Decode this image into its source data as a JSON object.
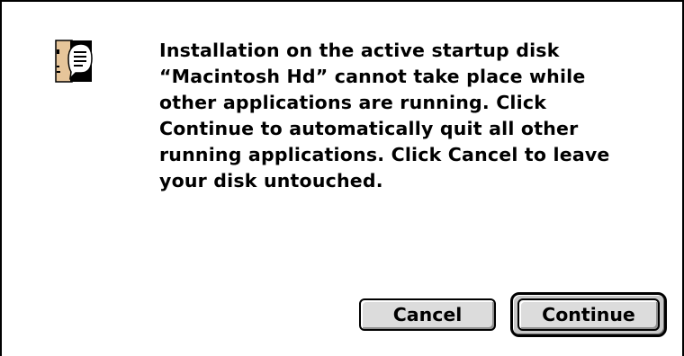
{
  "dialog": {
    "message": "Installation on the active startup disk\n“Macintosh Hd” cannot take place while\nother applications are running.  Click\nContinue to automatically quit all other\nrunning applications.  Click Cancel to leave\nyour disk untouched.",
    "icon": "note-alert-icon"
  },
  "buttons": {
    "cancel_label": "Cancel",
    "continue_label": "Continue"
  },
  "colors": {
    "button_face": "#dcdcdc",
    "border": "#000000",
    "background": "#ffffff"
  }
}
